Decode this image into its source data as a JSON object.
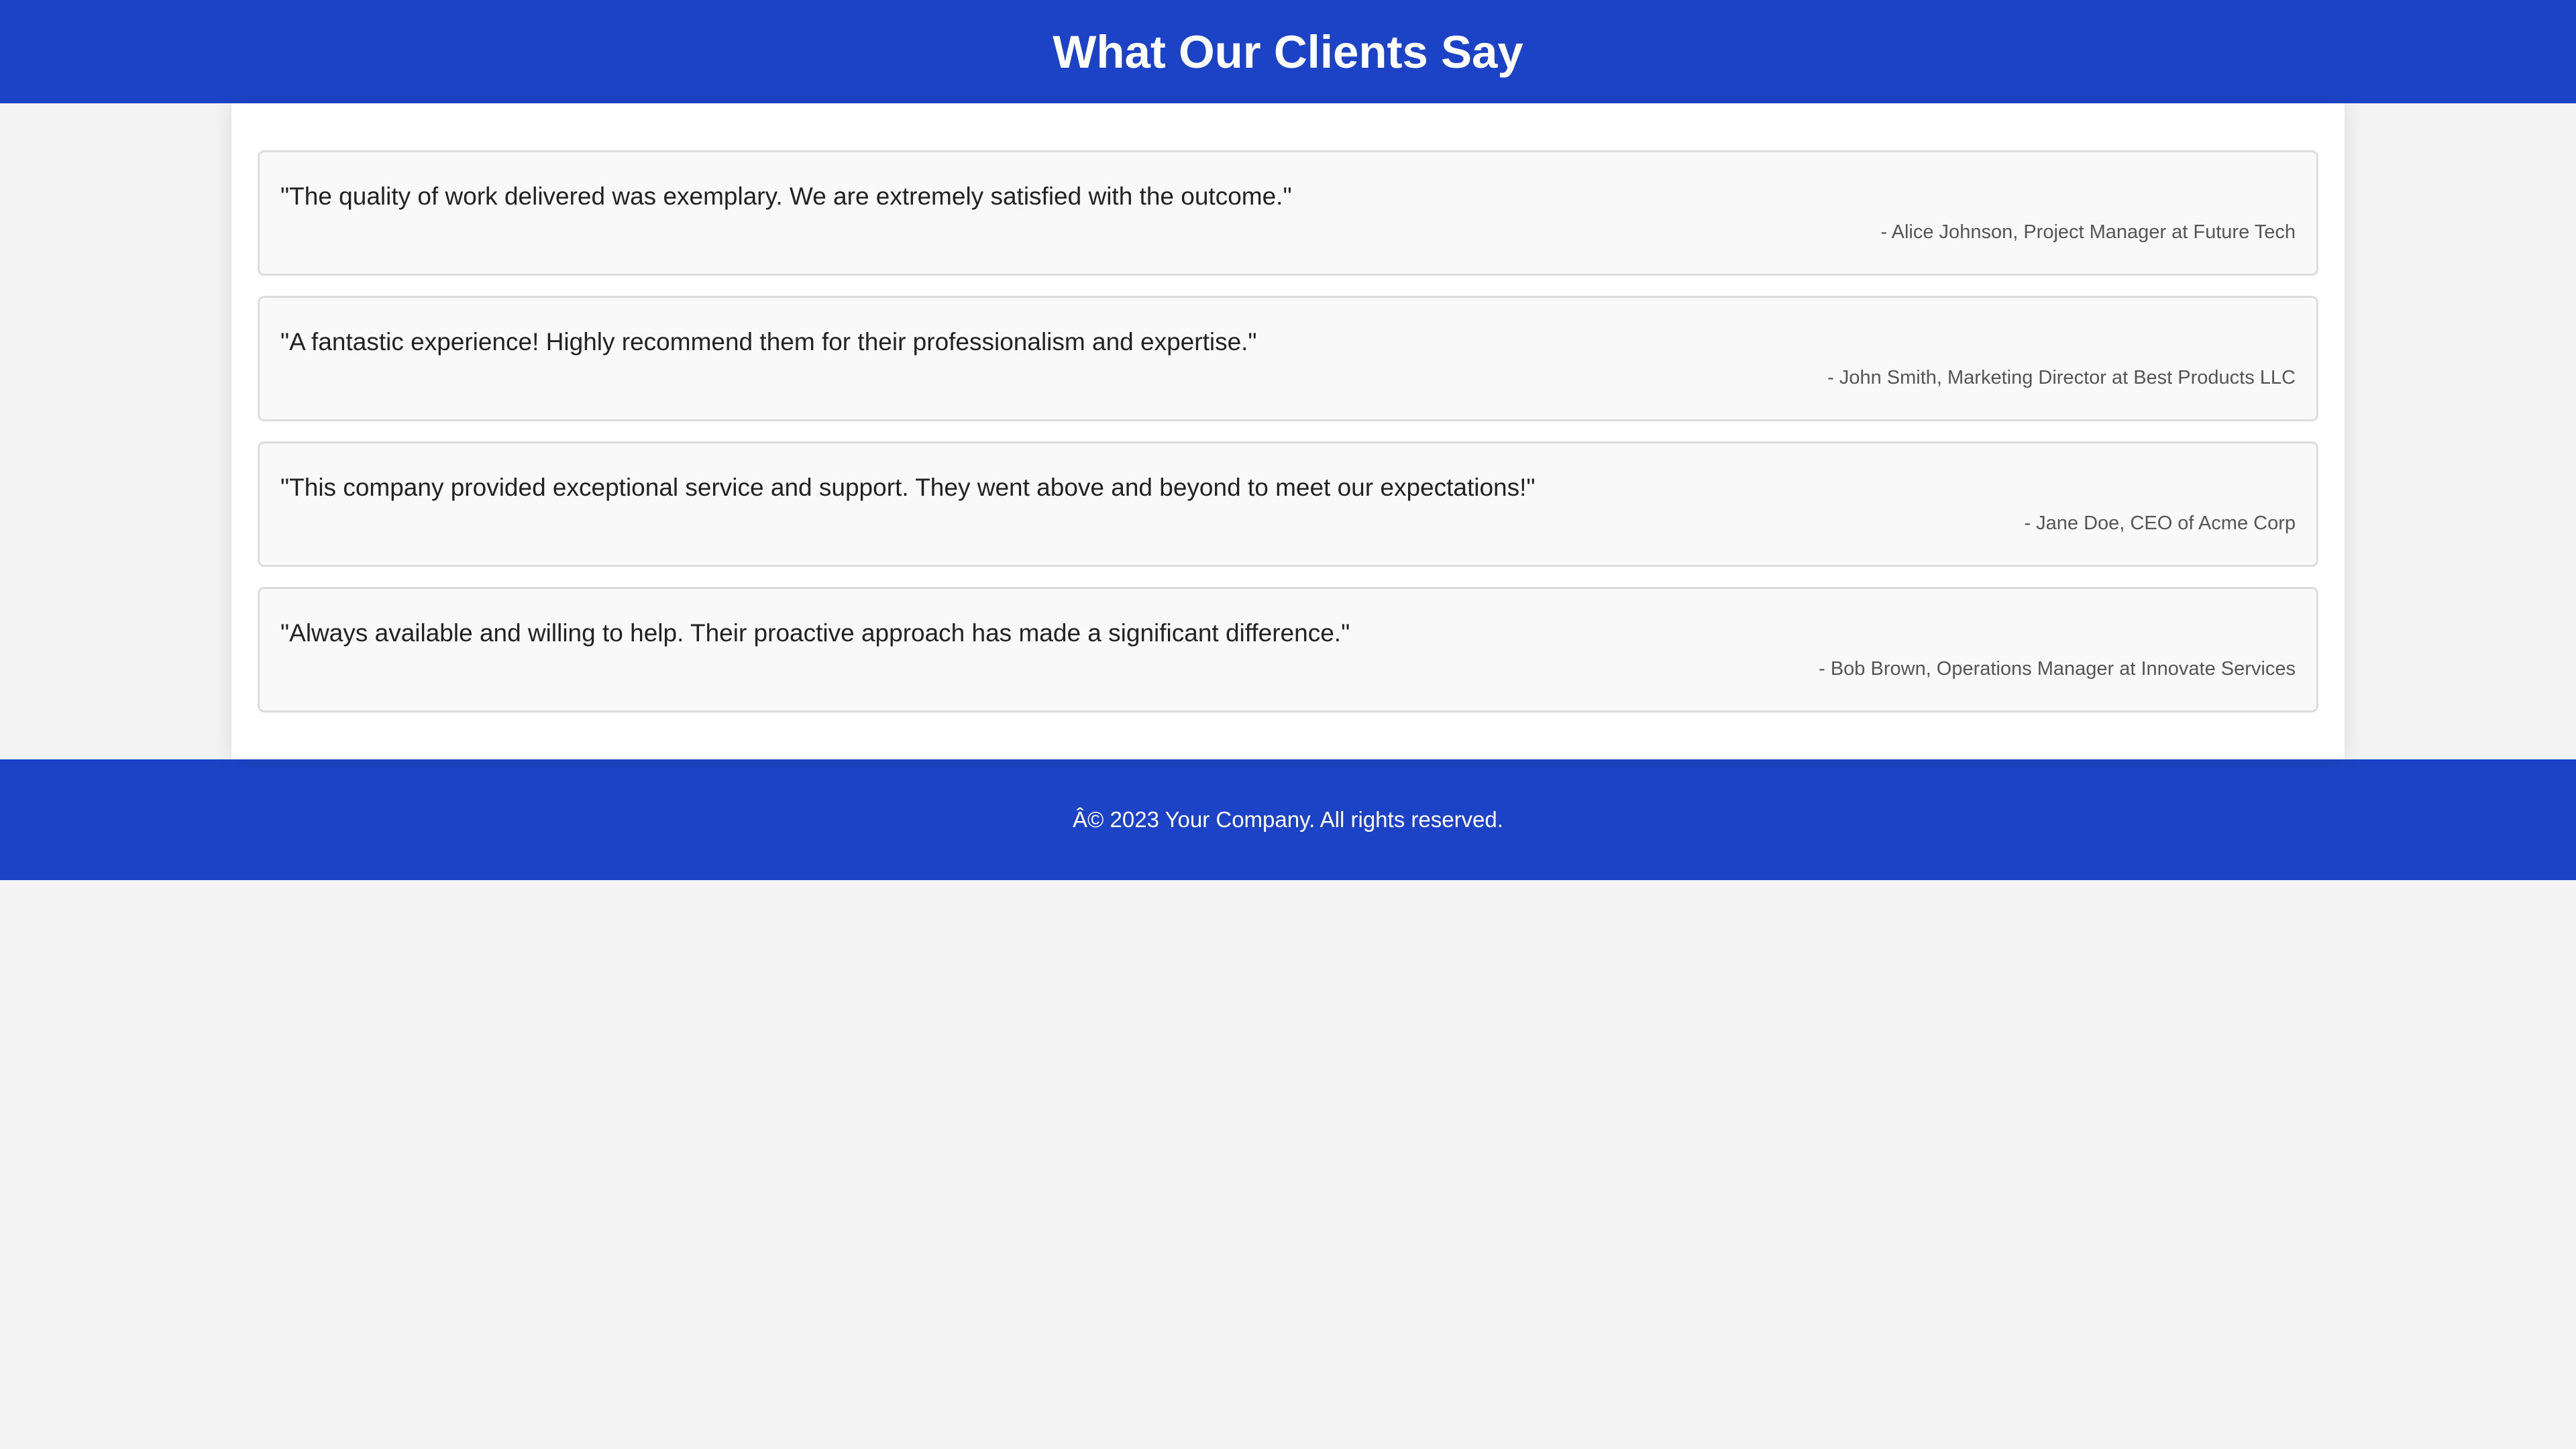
{
  "header": {
    "title": "What Our Clients Say"
  },
  "testimonials": [
    {
      "quote": "\"The quality of work delivered was exemplary. We are extremely satisfied with the outcome.\"",
      "author": "- Alice Johnson, Project Manager at Future Tech"
    },
    {
      "quote": "\"A fantastic experience! Highly recommend them for their professionalism and expertise.\"",
      "author": "- John Smith, Marketing Director at Best Products LLC"
    },
    {
      "quote": "\"This company provided exceptional service and support. They went above and beyond to meet our expectations!\"",
      "author": "- Jane Doe, CEO of Acme Corp"
    },
    {
      "quote": "\"Always available and willing to help. Their proactive approach has made a significant difference.\"",
      "author": "- Bob Brown, Operations Manager at Innovate Services"
    }
  ],
  "footer": {
    "text": "Â© 2023 Your Company. All rights reserved."
  },
  "colors": {
    "brand_blue": "#1c43c5",
    "page_background": "#f3f3f3",
    "card_background": "#f9f9f9"
  }
}
